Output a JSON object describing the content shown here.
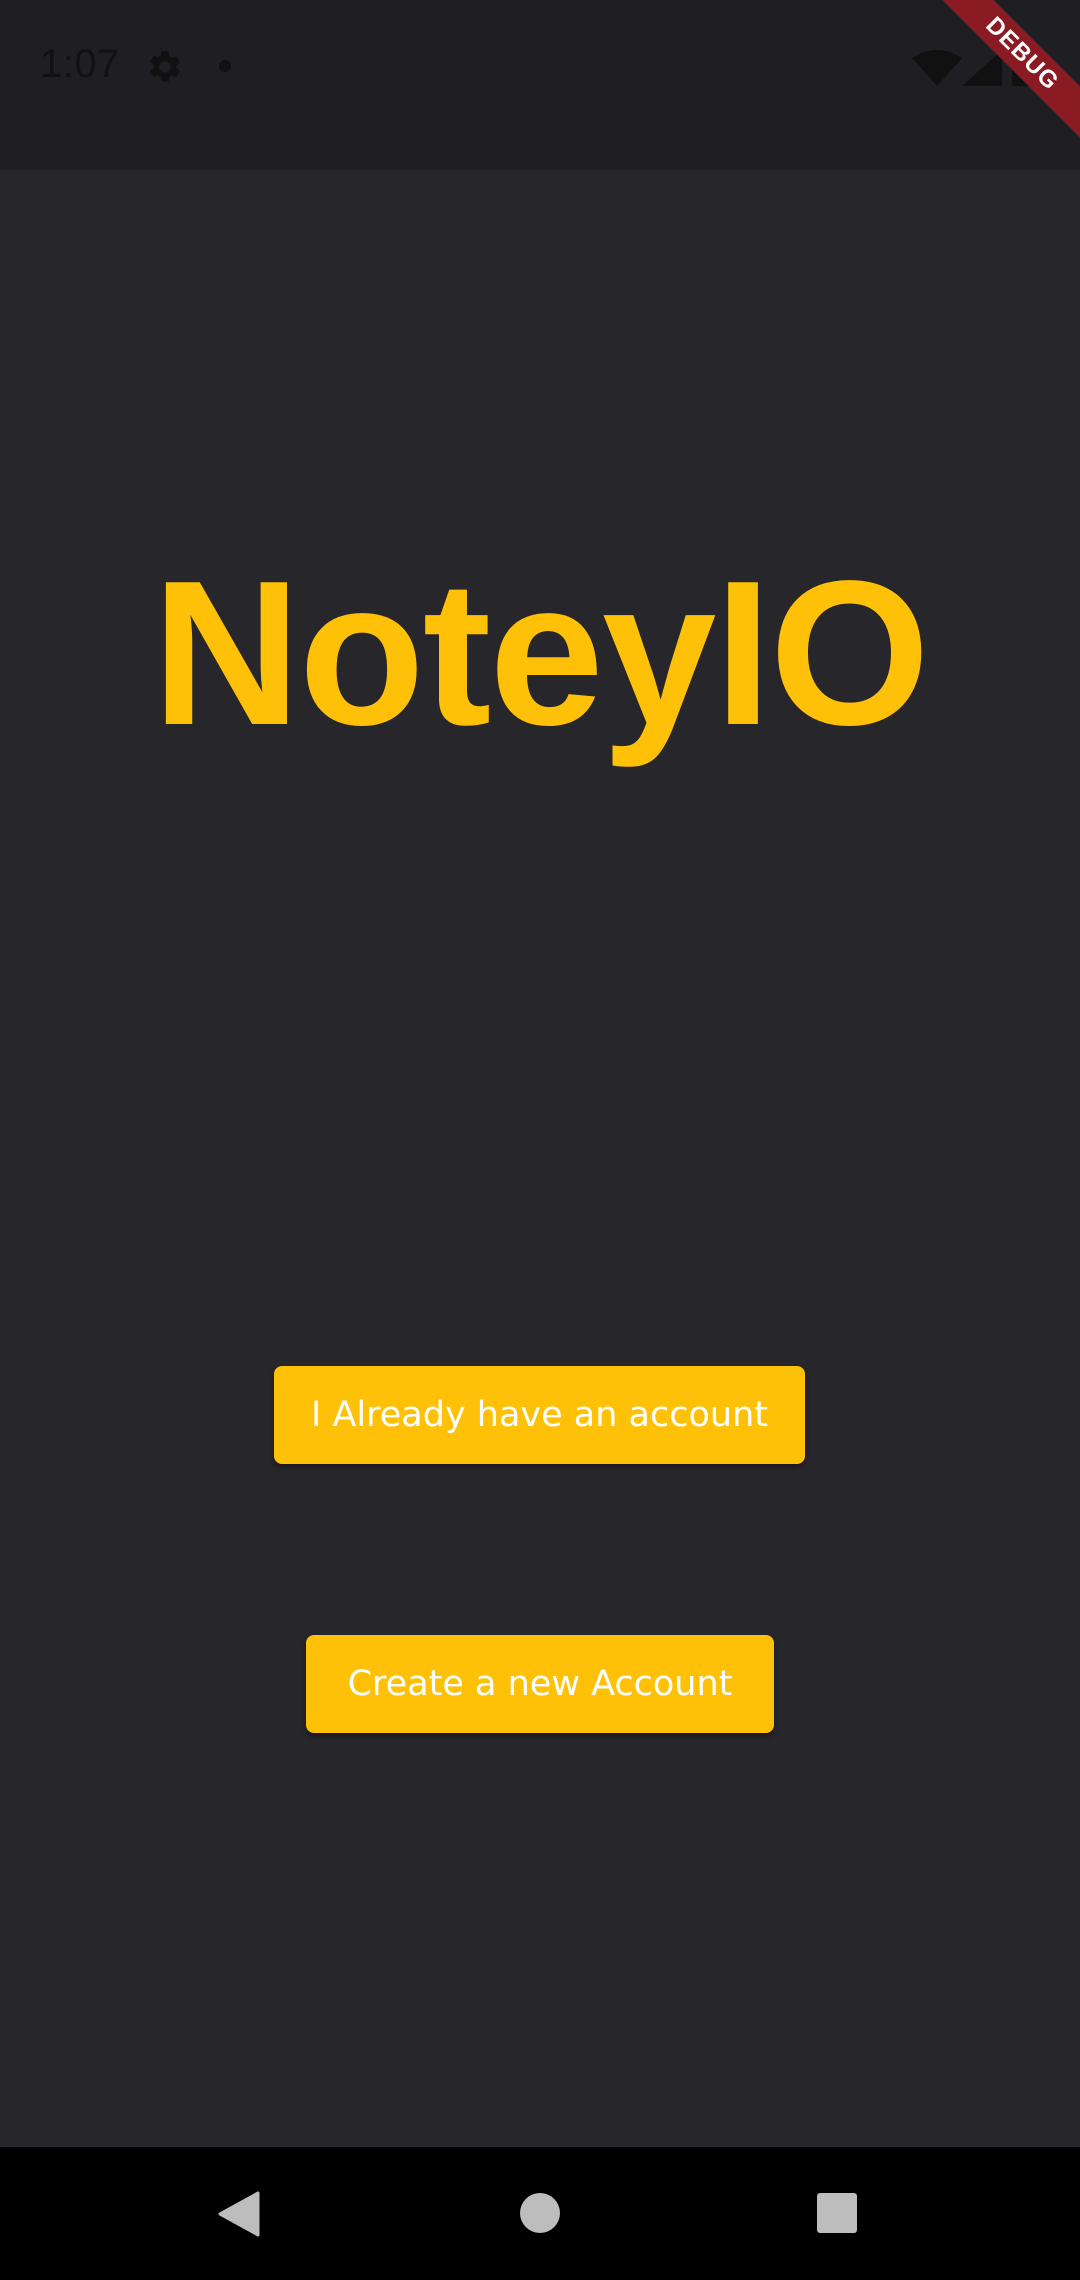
{
  "status_bar": {
    "time": "1:07",
    "icons": [
      "gear-icon",
      "notification-dot-icon",
      "wifi-icon",
      "signal-icon",
      "battery-icon"
    ]
  },
  "debug_banner": {
    "label": "DEBUG",
    "color": "#8b1b22"
  },
  "app": {
    "title": "NoteyIO",
    "accent_color": "#fec107",
    "background_color": "#27262b"
  },
  "buttons": {
    "login_label": "I Already have an account",
    "create_label": "Create a new Account"
  },
  "navigation_bar": {
    "icons": [
      "back-icon",
      "home-icon",
      "recents-icon"
    ]
  }
}
